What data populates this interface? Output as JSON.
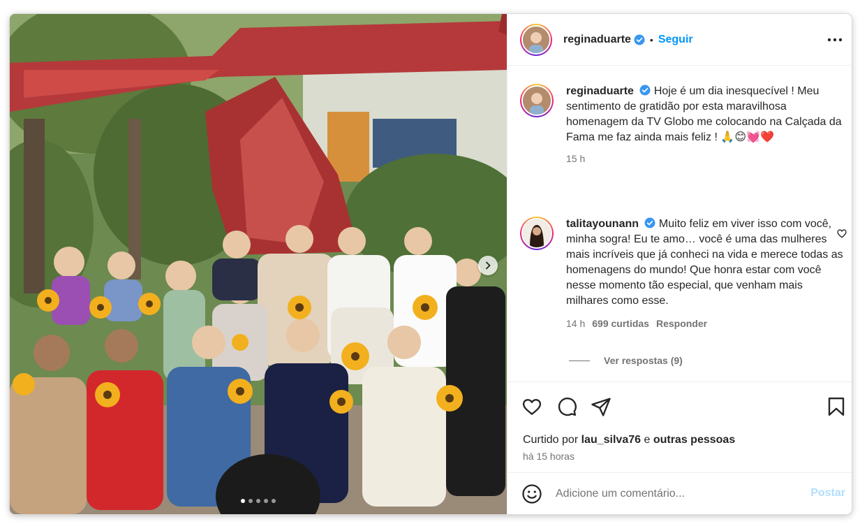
{
  "post": {
    "image_alt": "Group photo in front of a red sculpture with sunflower bouquets",
    "carousel": {
      "total": 5,
      "current": 1
    }
  },
  "header": {
    "username": "reginaduarte",
    "verified": true,
    "separator": "•",
    "follow_label": "Seguir"
  },
  "caption": {
    "username": "reginaduarte",
    "text": "Hoje é um dia inesquecível ! Meu sentimento de gratidão por esta maravilhosa homenagem da TV Globo me colocando na Calçada da Fama me faz ainda mais feliz ! 🙏😊💓❤️",
    "time": "15 h"
  },
  "comments": [
    {
      "username": "talitayounann",
      "verified": true,
      "text": "Muito feliz em viver isso com você, minha sogra! Eu te amo… você é uma das mulheres mais incríveis que já conheci na vida e merece todas as homenagens do mundo! Que honra estar com você nesse momento tão especial, que venham mais milhares como esse.",
      "time": "14 h",
      "likes": "699 curtidas",
      "reply_label": "Responder",
      "view_replies": "Ver respostas (9)"
    }
  ],
  "likes": {
    "prefix": "Curtido por",
    "user": "lau_silva76",
    "conj": "e",
    "others": "outras pessoas"
  },
  "post_time": "há 15 horas",
  "add_comment": {
    "placeholder": "Adicione um comentário...",
    "post_label": "Postar"
  },
  "colors": {
    "accent": "#0095f6",
    "verified": "#3897f0",
    "post_disabled": "#b2dffc",
    "secondary_text": "#737373",
    "sculpture_red": "#b5393a"
  },
  "icons": {
    "like": "heart-icon",
    "comment": "comment-icon",
    "share": "send-icon",
    "save": "bookmark-icon",
    "more": "more-icon",
    "emoji": "emoji-icon",
    "next": "chevron-right-icon"
  }
}
